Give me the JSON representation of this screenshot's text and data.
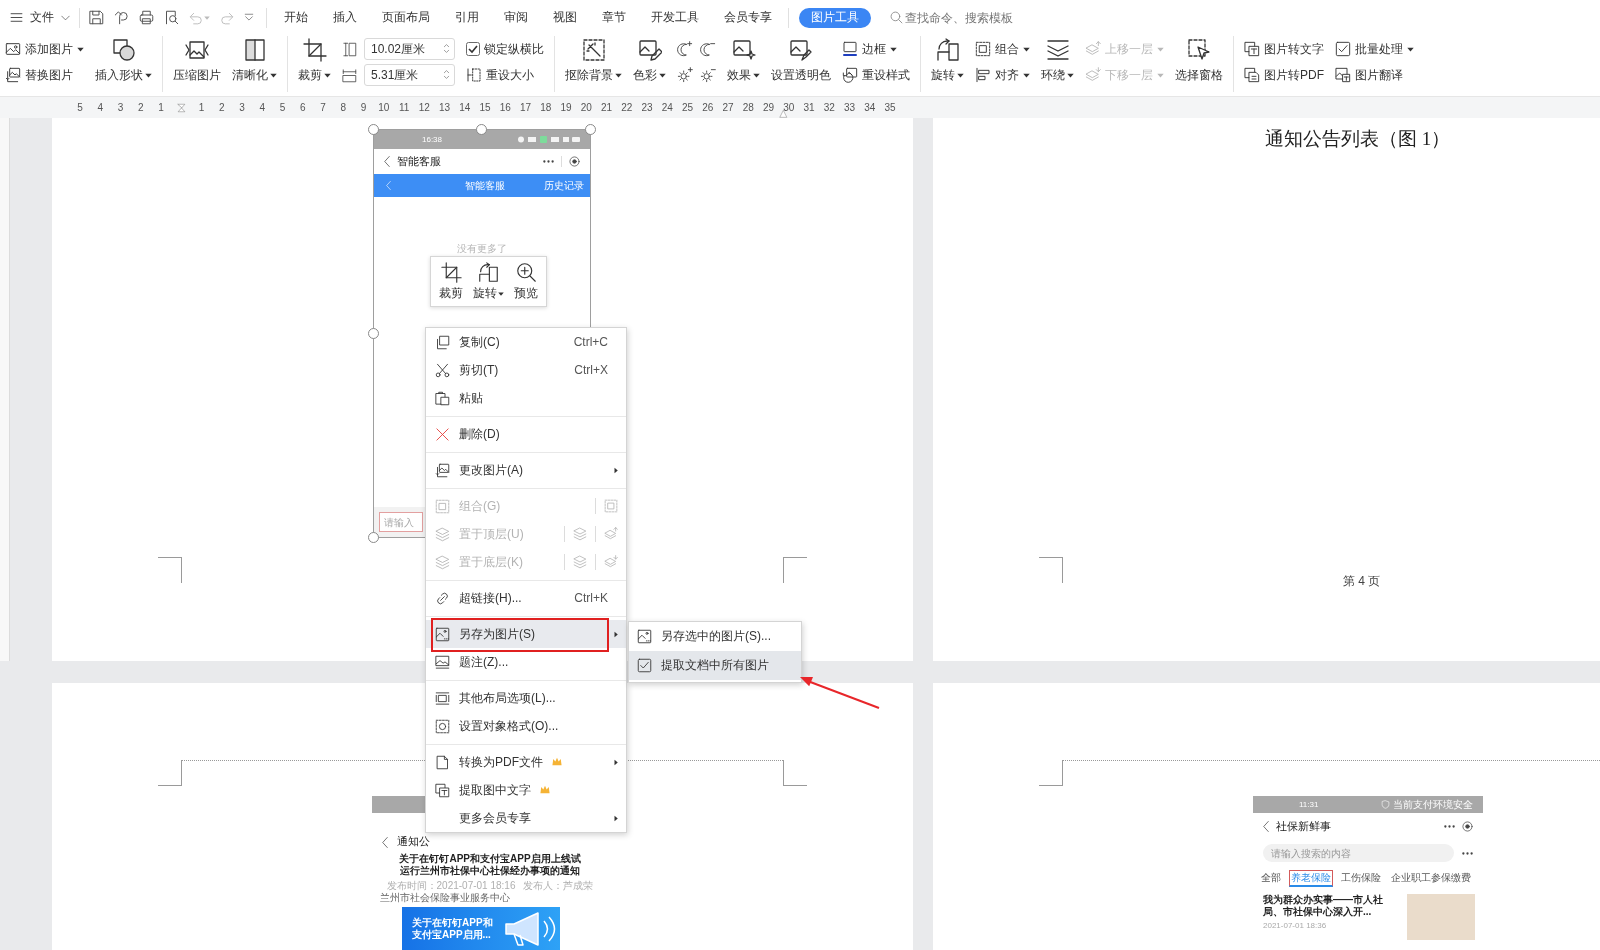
{
  "menubar": {
    "file_menu": {
      "label": "文件"
    },
    "tabs": [
      {
        "label": "开始",
        "selected": false
      },
      {
        "label": "插入",
        "selected": false
      },
      {
        "label": "页面布局",
        "selected": false
      },
      {
        "label": "引用",
        "selected": false
      },
      {
        "label": "审阅",
        "selected": false
      },
      {
        "label": "视图",
        "selected": false
      },
      {
        "label": "章节",
        "selected": false
      },
      {
        "label": "开发工具",
        "selected": false
      },
      {
        "label": "会员专享",
        "selected": false
      },
      {
        "label": "图片工具",
        "selected": true
      }
    ],
    "search": {
      "placeholder": "查找命令、搜索模板"
    }
  },
  "ribbon": [
    [
      {
        "kind": "stack",
        "items": [
          {
            "kind": "button",
            "label": "添加图片",
            "dropdown": true,
            "disabled": false
          },
          {
            "kind": "button",
            "label": "替换图片",
            "dropdown": false,
            "disabled": false
          }
        ]
      },
      {
        "kind": "large",
        "label": "插入形状",
        "dropdown": true,
        "disabled": false
      }
    ],
    [
      {
        "kind": "large",
        "label": "压缩图片",
        "dropdown": false,
        "disabled": false
      },
      {
        "kind": "large",
        "label": "清晰化",
        "dropdown": true,
        "disabled": false
      }
    ],
    [
      {
        "kind": "large",
        "label": "裁剪",
        "dropdown": true,
        "disabled": false
      },
      {
        "kind": "size_fields",
        "fields": [
          {
            "value": "10.02厘米"
          },
          {
            "value": "5.31厘米"
          }
        ]
      },
      {
        "kind": "stack",
        "items": [
          {
            "kind": "checkbox",
            "label": "锁定纵横比",
            "checked": true,
            "dropdown": false,
            "disabled": false
          },
          {
            "kind": "button",
            "label": "重设大小",
            "dropdown": false,
            "disabled": false
          }
        ]
      }
    ],
    [
      {
        "kind": "large",
        "label": "抠除背景",
        "dropdown": true,
        "disabled": false
      },
      {
        "kind": "large",
        "label": "色彩",
        "dropdown": true,
        "disabled": false
      },
      {
        "kind": "icon_grid"
      },
      {
        "kind": "large",
        "label": "效果",
        "dropdown": true,
        "disabled": false
      },
      {
        "kind": "large",
        "label": "设置透明色",
        "dropdown": false,
        "disabled": false
      },
      {
        "kind": "stack",
        "items": [
          {
            "kind": "button",
            "label": "边框",
            "dropdown": true,
            "disabled": false
          },
          {
            "kind": "button",
            "label": "重设样式",
            "dropdown": false,
            "disabled": false
          }
        ]
      }
    ],
    [
      {
        "kind": "large",
        "label": "旋转",
        "dropdown": true,
        "disabled": false
      },
      {
        "kind": "stack",
        "items": [
          {
            "kind": "button",
            "label": "组合",
            "dropdown": true,
            "disabled": false
          },
          {
            "kind": "button",
            "label": "对齐",
            "dropdown": true,
            "disabled": false
          }
        ]
      },
      {
        "kind": "large",
        "label": "环绕",
        "dropdown": true,
        "disabled": false
      },
      {
        "kind": "stack",
        "items": [
          {
            "kind": "button",
            "label": "上移一层",
            "dropdown": true,
            "disabled": true
          },
          {
            "kind": "button",
            "label": "下移一层",
            "dropdown": true,
            "disabled": true
          }
        ]
      },
      {
        "kind": "large",
        "label": "选择窗格",
        "dropdown": false,
        "disabled": false
      }
    ],
    [
      {
        "kind": "stack",
        "items": [
          {
            "kind": "button",
            "label": "图片转文字",
            "dropdown": false,
            "disabled": false
          },
          {
            "kind": "button",
            "label": "图片转PDF",
            "dropdown": false,
            "disabled": false
          }
        ]
      },
      {
        "kind": "stack",
        "items": [
          {
            "kind": "button",
            "label": "批量处理",
            "dropdown": true,
            "disabled": false
          },
          {
            "kind": "button",
            "label": "图片翻译",
            "dropdown": false,
            "disabled": false
          }
        ]
      }
    ]
  ],
  "ruler": {
    "left_numbers": [
      "5",
      "4",
      "3",
      "2",
      "1"
    ],
    "numbers": [
      "1",
      "2",
      "3",
      "4",
      "5",
      "6",
      "7",
      "8",
      "9",
      "10",
      "11",
      "12",
      "13",
      "14",
      "15",
      "16",
      "17",
      "18",
      "19",
      "20",
      "21",
      "22",
      "23",
      "24",
      "25",
      "26",
      "27",
      "28",
      "29",
      "30",
      "31",
      "32",
      "33",
      "34",
      "35"
    ]
  },
  "page_top_left": {
    "picture": {
      "status_time": "16:38",
      "header_title": "智能客服",
      "title_bar": {
        "title": "智能客服",
        "link": "历史记录"
      },
      "empty_note": "没有更多了",
      "input": {
        "placeholder": "请输入"
      }
    }
  },
  "mini_toolbar": {
    "items": [
      {
        "label": "裁剪",
        "dropdown": false
      },
      {
        "label": "旋转",
        "dropdown": true
      },
      {
        "label": "预览",
        "dropdown": false
      }
    ]
  },
  "context_menu": {
    "items": [
      {
        "kind": "item",
        "label": "复制(C)",
        "shortcut": "Ctrl+C",
        "disabled": false,
        "highlighted": false,
        "boxed": false,
        "has_submenu": false,
        "member_only": false
      },
      {
        "kind": "item",
        "label": "剪切(T)",
        "shortcut": "Ctrl+X",
        "disabled": false,
        "highlighted": false,
        "boxed": false,
        "has_submenu": false,
        "member_only": false
      },
      {
        "kind": "item",
        "label": "粘贴",
        "disabled": false,
        "highlighted": false,
        "boxed": false,
        "has_submenu": false,
        "member_only": false
      },
      {
        "kind": "separator"
      },
      {
        "kind": "item",
        "label": "删除(D)",
        "disabled": false,
        "highlighted": false,
        "boxed": false,
        "has_submenu": false,
        "member_only": false
      },
      {
        "kind": "separator"
      },
      {
        "kind": "item",
        "label": "更改图片(A)",
        "disabled": false,
        "highlighted": false,
        "boxed": false,
        "has_submenu": true,
        "member_only": false
      },
      {
        "kind": "separator"
      },
      {
        "kind": "split",
        "label": "组合(G)",
        "disabled": true,
        "highlighted": false,
        "boxed": false,
        "has_submenu": false,
        "member_only": false
      },
      {
        "kind": "split",
        "label": "置于顶层(U)",
        "disabled": true,
        "highlighted": false,
        "boxed": false,
        "has_submenu": false,
        "member_only": false
      },
      {
        "kind": "split",
        "label": "置于底层(K)",
        "disabled": true,
        "highlighted": false,
        "boxed": false,
        "has_submenu": false,
        "member_only": false
      },
      {
        "kind": "separator"
      },
      {
        "kind": "item",
        "label": "超链接(H)...",
        "shortcut": "Ctrl+K",
        "disabled": false,
        "highlighted": false,
        "boxed": false,
        "has_submenu": false,
        "member_only": false
      },
      {
        "kind": "separator"
      },
      {
        "kind": "item",
        "label": "另存为图片(S)",
        "disabled": false,
        "highlighted": true,
        "boxed": true,
        "has_submenu": true,
        "member_only": false,
        "submenu": [
          {
            "label": "另存选中的图片(S)...",
            "highlighted": false,
            "arrow": false
          },
          {
            "label": "提取文档中所有图片",
            "highlighted": true,
            "arrow": true
          }
        ]
      },
      {
        "kind": "item",
        "label": "题注(Z)...",
        "disabled": false,
        "highlighted": false,
        "boxed": false,
        "has_submenu": false,
        "member_only": false
      },
      {
        "kind": "separator"
      },
      {
        "kind": "item",
        "label": "其他布局选项(L)...",
        "disabled": false,
        "highlighted": false,
        "boxed": false,
        "has_submenu": false,
        "member_only": false
      },
      {
        "kind": "item",
        "label": "设置对象格式(O)...",
        "disabled": false,
        "highlighted": false,
        "boxed": false,
        "has_submenu": false,
        "member_only": false
      },
      {
        "kind": "separator"
      },
      {
        "kind": "item",
        "label": "转换为PDF文件",
        "disabled": false,
        "highlighted": false,
        "boxed": false,
        "has_submenu": true,
        "member_only": true
      },
      {
        "kind": "item",
        "label": "提取图中文字",
        "disabled": false,
        "highlighted": false,
        "boxed": false,
        "has_submenu": false,
        "member_only": true
      },
      {
        "kind": "item",
        "label": "更多会员专享",
        "disabled": false,
        "highlighted": false,
        "boxed": false,
        "has_submenu": true,
        "member_only": false
      }
    ]
  },
  "page_top_right": {
    "title": "通知公告列表（图 1）",
    "page_number": "第 4 页"
  },
  "page_bottom_left": {
    "picture": {
      "header_title": "通知公",
      "title_lines": [
        "关于在钉钉APP和支付宝APP启用上线试",
        "运行兰州市社保中心社保经办事项的通知"
      ],
      "meta": [
        "发布时间：2021-07-01 18:16",
        "发布人：芦成荣"
      ],
      "source": "兰州市社会保险事业服务中心",
      "banner_lines": [
        "关于在钉钉APP和",
        "支付宝APP启用..."
      ]
    }
  },
  "page_bottom_right": {
    "picture": {
      "status_time": "11:31",
      "status_note": "当前支付环境安全",
      "header_title": "社保新鲜事",
      "search": {
        "placeholder": "请输入搜索的内容"
      },
      "tabs": [
        {
          "label": "全部",
          "selected": false
        },
        {
          "label": "养老保险",
          "selected": true
        },
        {
          "label": "工伤保险",
          "selected": false
        },
        {
          "label": "企业职工参保缴费",
          "selected": false
        }
      ],
      "article": {
        "title_lines": [
          "我为群众办实事——市人社",
          "局、市社保中心深入开..."
        ],
        "date": "2021-07-01 18:36"
      }
    }
  }
}
